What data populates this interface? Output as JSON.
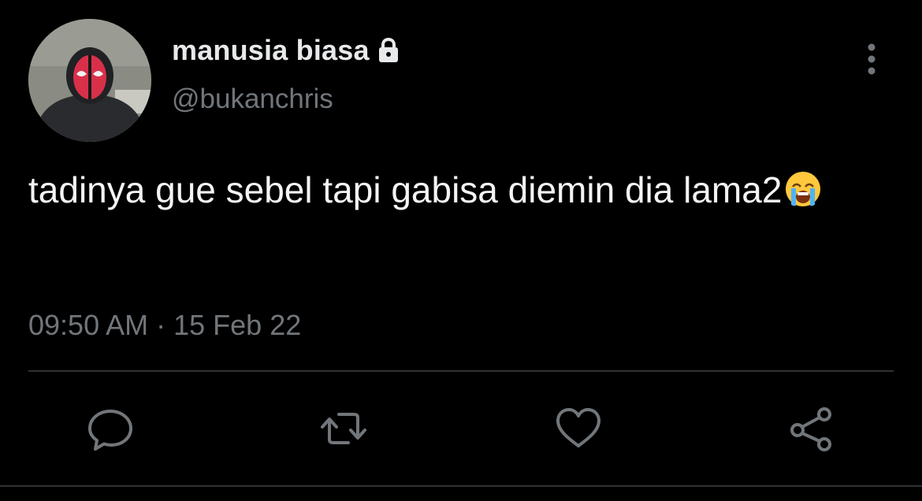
{
  "tweet": {
    "display_name": "manusia biasa",
    "handle": "@bukanchris",
    "text": "tadinya gue sebel tapi gabisa diemin dia lama2",
    "emoji": "loudly-crying-face",
    "time": "09:50 AM",
    "separator": "·",
    "date": "15 Feb 22",
    "protected": true
  },
  "icons": {
    "lock": "lock-icon",
    "more": "more-vertical-icon",
    "reply": "reply-icon",
    "retweet": "retweet-icon",
    "like": "heart-icon",
    "share": "share-icon"
  },
  "colors": {
    "background": "#000000",
    "primary_text": "#e7e9ea",
    "secondary_text": "#71767b",
    "divider": "#2f3336"
  }
}
